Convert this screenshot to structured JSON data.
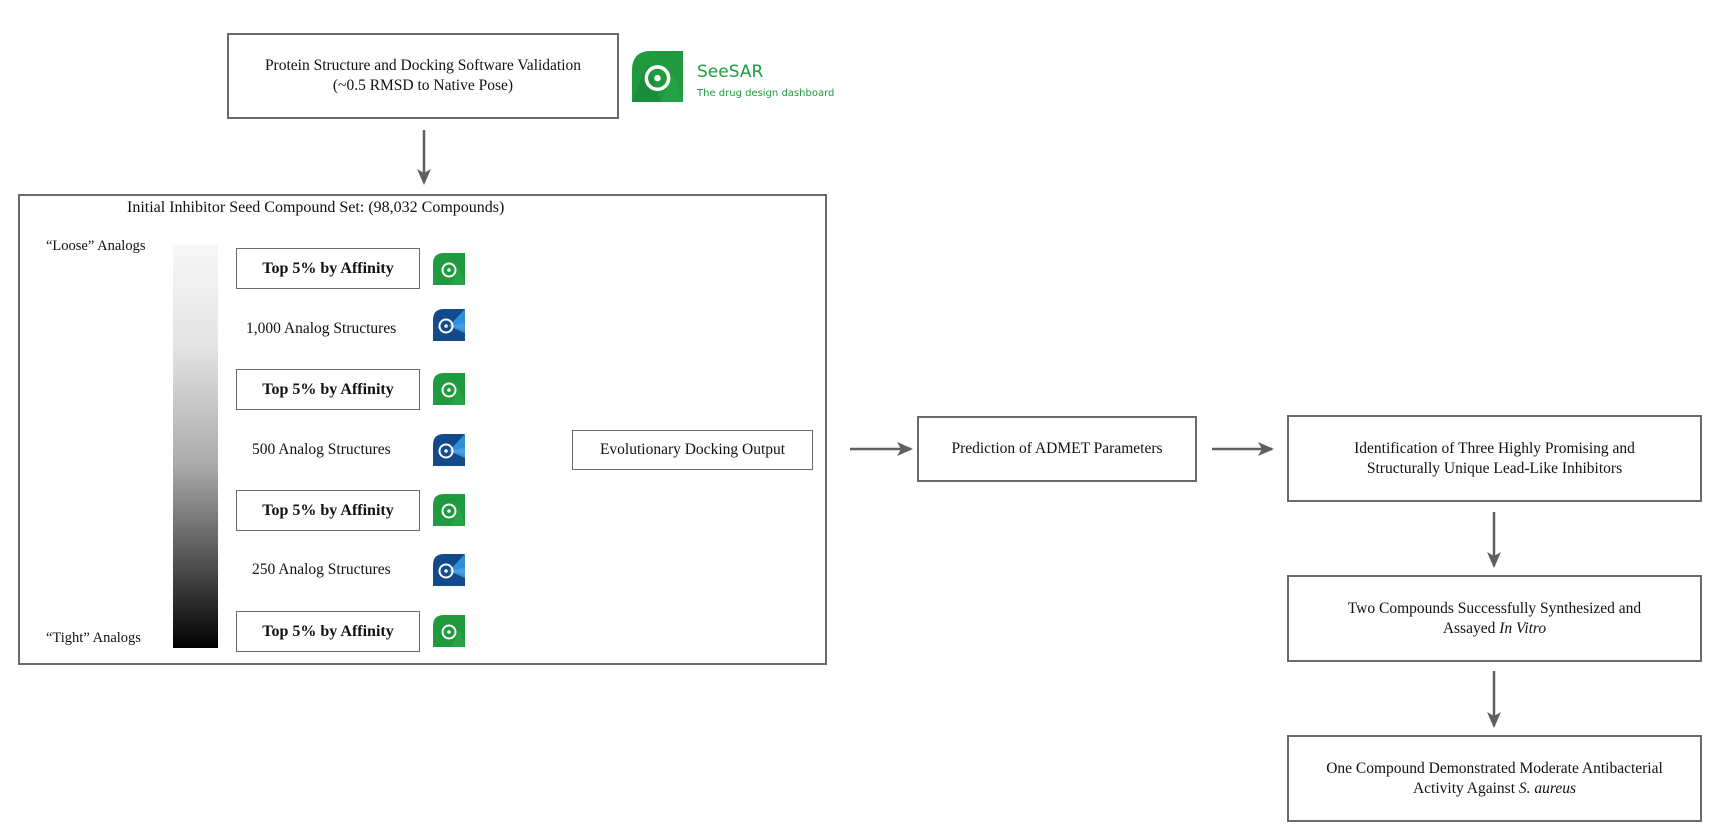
{
  "top_box": {
    "line1": "Protein Structure and Docking Software Validation",
    "line2": "(~0.5 RMSD to Native Pose)"
  },
  "seesar_logo": {
    "icon": "seesar-logo-icon",
    "title": "SeeSAR",
    "subtitle": "The drug design dashboard",
    "color": "#1f9a3f"
  },
  "panel": {
    "title": "Initial Inhibitor Seed Compound Set: (98,032 Compounds)",
    "gradient": {
      "top_label": "“Loose” Analogs",
      "bottom_label": "“Tight” Analogs"
    },
    "steps": [
      {
        "filter": "Top 5% by Affinity",
        "icon": "seesar-icon",
        "analogs": "1,000 Analog Structures",
        "analog_icon": "analog-generator-icon"
      },
      {
        "filter": "Top 5% by Affinity",
        "icon": "seesar-icon",
        "analogs": "500 Analog Structures",
        "analog_icon": "analog-generator-icon"
      },
      {
        "filter": "Top 5% by Affinity",
        "icon": "seesar-icon",
        "analogs": "250 Analog Structures",
        "analog_icon": "analog-generator-icon"
      },
      {
        "filter": "Top 5% by Affinity",
        "icon": "seesar-icon"
      }
    ],
    "output": "Evolutionary Docking Output"
  },
  "admet": "Prediction of ADMET Parameters",
  "right_chain": [
    {
      "line1": "Identification of Three Highly Promising and",
      "line2": "Structurally Unique Lead-Like Inhibitors"
    },
    {
      "line1": "Two Compounds Successfully Synthesized and",
      "line2_plain": "Assayed ",
      "line2_italic": "In Vitro"
    },
    {
      "line1": "One Compound Demonstrated Moderate Antibacterial",
      "line2_plain": "Activity Against ",
      "line2_italic": "S. aureus"
    }
  ],
  "colors": {
    "seesar_green": "#1f9a3f",
    "analog_blue": "#124a8a",
    "line_gray": "#6a6a6a"
  }
}
